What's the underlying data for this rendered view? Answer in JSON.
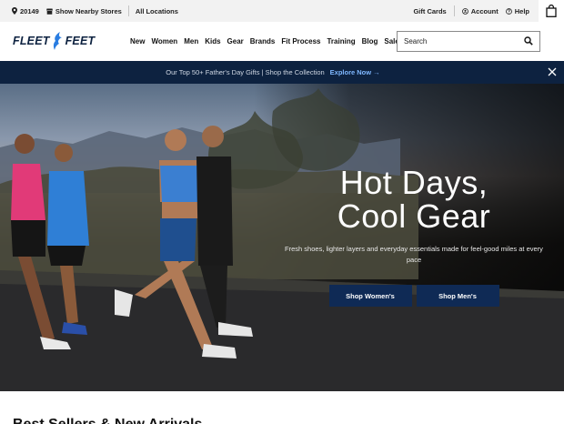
{
  "utility_bar": {
    "zip": "20149",
    "nearby": "Show Nearby Stores",
    "all_locations": "All Locations",
    "gift_cards": "Gift Cards",
    "account": "Account",
    "help": "Help"
  },
  "header": {
    "logo_left": "FLEET",
    "logo_right": "FEET",
    "nav": [
      "New",
      "Women",
      "Men",
      "Kids",
      "Gear",
      "Brands",
      "Fit Process",
      "Training",
      "Blog",
      "Sale"
    ],
    "search_placeholder": "Search"
  },
  "promo": {
    "text": "Our Top 50+ Father's Day Gifts | Shop the Collection",
    "cta": "Explore Now →"
  },
  "hero": {
    "headline_line1": "Hot Days,",
    "headline_line2": "Cool Gear",
    "subtext": "Fresh shoes, lighter layers and everyday essentials made for feel-good miles at every pace",
    "btn_women": "Shop Women's",
    "btn_men": "Shop Men's"
  },
  "section": {
    "title": "Best Sellers & New Arrivals"
  },
  "colors": {
    "navy": "#0d2240",
    "button": "#0f2a55",
    "accent_link": "#7fb8ff"
  }
}
